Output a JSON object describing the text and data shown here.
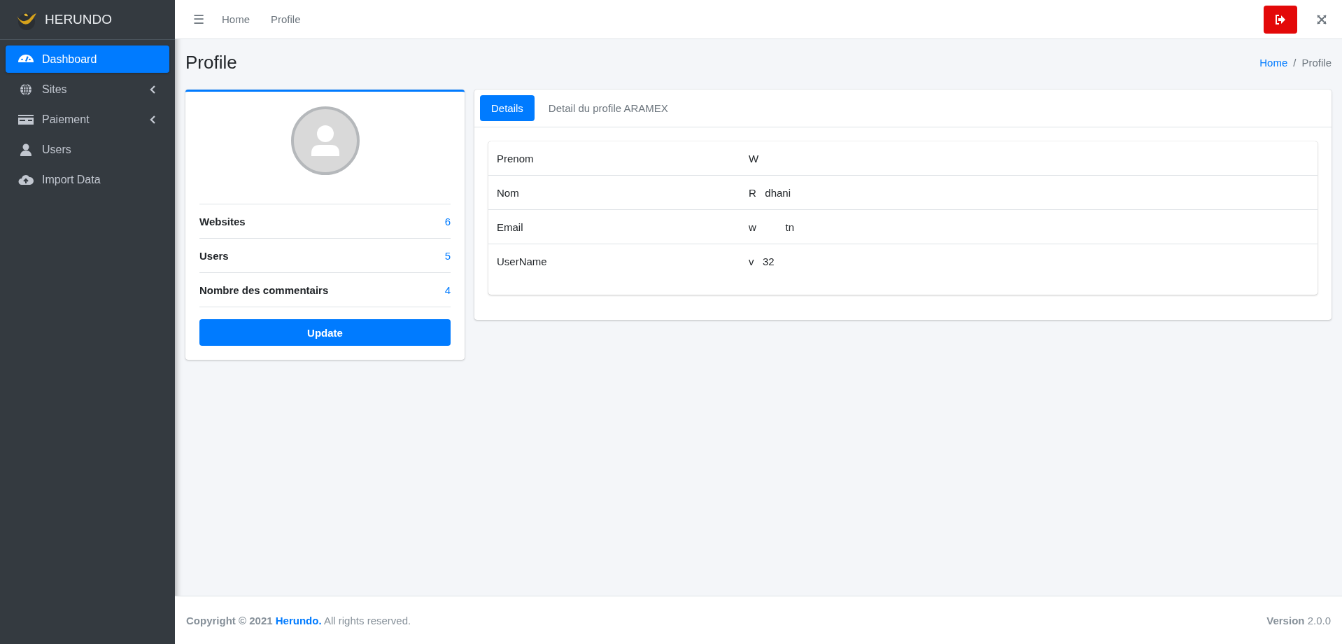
{
  "brand": {
    "name": "HERUNDO"
  },
  "sidebar": {
    "items": [
      {
        "label": "Dashboard",
        "kind": "gauge",
        "selected": true,
        "has_children": false
      },
      {
        "label": "Sites",
        "kind": "globe",
        "selected": false,
        "has_children": true
      },
      {
        "label": "Paiement",
        "kind": "card",
        "selected": false,
        "has_children": true
      },
      {
        "label": "Users",
        "kind": "user",
        "selected": false,
        "has_children": false
      },
      {
        "label": "Import Data",
        "kind": "upload",
        "selected": false,
        "has_children": false
      }
    ]
  },
  "topbar": {
    "menu_icon": "☰",
    "links": [
      "Home",
      "Profile"
    ]
  },
  "page": {
    "title": "Profile",
    "breadcrumb": [
      "Home",
      "Profile"
    ],
    "breadcrumb_separator": "/"
  },
  "profile_card": {
    "stats": [
      {
        "label": "Websites",
        "value": "6"
      },
      {
        "label": "Users",
        "value": "5"
      },
      {
        "label": "Nombre des commentairs",
        "value": "4"
      }
    ],
    "button": "Update"
  },
  "details_card": {
    "tabs": [
      {
        "label": "Details",
        "selected": true
      },
      {
        "label": "Detail du profile ARAMEX",
        "selected": false
      }
    ],
    "rows": [
      {
        "label": "Prenom",
        "value": "W"
      },
      {
        "label": "Nom",
        "value": "R   dhani"
      },
      {
        "label": "Email",
        "value": "w          tn"
      },
      {
        "label": "UserName",
        "value": "v   32"
      }
    ]
  },
  "footer": {
    "copyright": "**Copyright © 2021** ",
    "brand": "Herundo.",
    "rest": " All rights reserved.",
    "version_label": "Version",
    "version": "2.0.0"
  }
}
